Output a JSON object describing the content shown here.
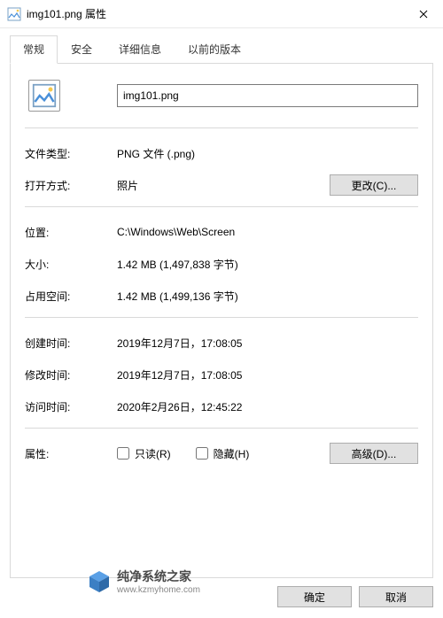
{
  "titlebar": {
    "title": "img101.png 属性"
  },
  "tabs": [
    {
      "label": "常规",
      "active": true
    },
    {
      "label": "安全",
      "active": false
    },
    {
      "label": "详细信息",
      "active": false
    },
    {
      "label": "以前的版本",
      "active": false
    }
  ],
  "filename": "img101.png",
  "props": {
    "type_label": "文件类型:",
    "type_value": "PNG 文件 (.png)",
    "open_label": "打开方式:",
    "open_value": "照片",
    "change_btn": "更改(C)...",
    "loc_label": "位置:",
    "loc_value": "C:\\Windows\\Web\\Screen",
    "size_label": "大小:",
    "size_value": "1.42 MB (1,497,838 字节)",
    "disk_label": "占用空间:",
    "disk_value": "1.42 MB (1,499,136 字节)",
    "created_label": "创建时间:",
    "created_value": "2019年12月7日，17:08:05",
    "modified_label": "修改时间:",
    "modified_value": "2019年12月7日，17:08:05",
    "accessed_label": "访问时间:",
    "accessed_value": "2020年2月26日，12:45:22",
    "attr_label": "属性:",
    "readonly_label": "只读(R)",
    "hidden_label": "隐藏(H)",
    "advanced_btn": "高级(D)..."
  },
  "footer": {
    "ok": "确定",
    "cancel": "取消"
  },
  "watermark": {
    "brand": "纯净系统之家",
    "url": "www.kzmyhome.com"
  }
}
